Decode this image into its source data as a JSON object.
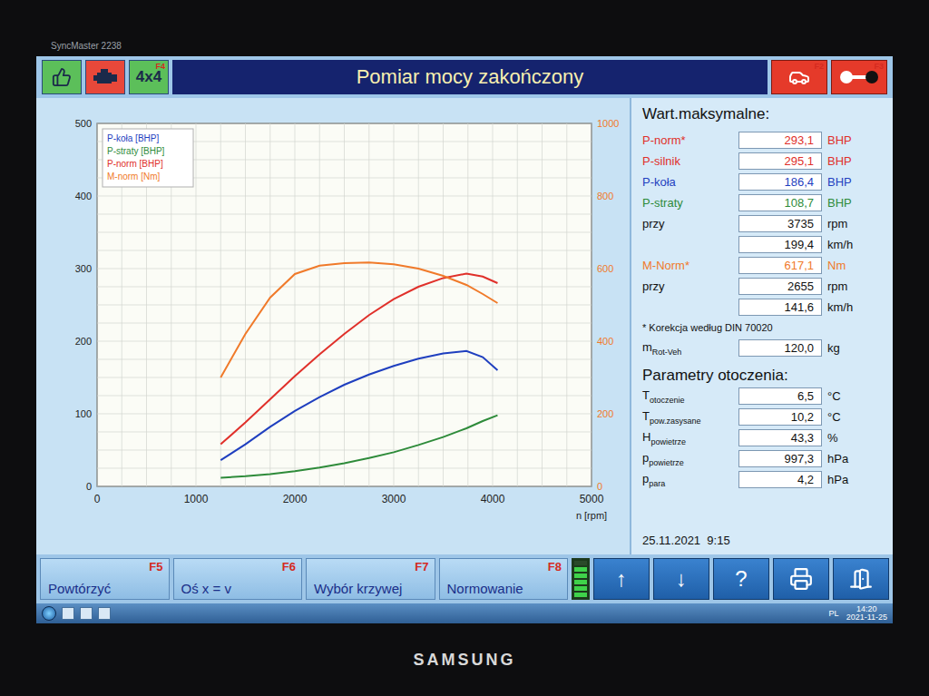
{
  "monitor": {
    "model": "SyncMaster 2238",
    "brand": "SAMSUNG"
  },
  "toolbar": {
    "left": [
      {
        "kind": "thumbs",
        "key": "",
        "color": "#5cbf5a"
      },
      {
        "kind": "engine",
        "key": "",
        "color": "#e8483a"
      },
      {
        "kind": "label",
        "label": "4x4",
        "key": "F4",
        "color": "#5cbf5a"
      }
    ],
    "title": "Pomiar mocy zakończony",
    "right": [
      {
        "kind": "car",
        "key": "F2"
      },
      {
        "kind": "switch",
        "key": "F3"
      }
    ]
  },
  "chart": {
    "y_left_ticks": [
      "0",
      "100",
      "200",
      "300",
      "400",
      "500"
    ],
    "y_right_ticks": [
      "0",
      "200",
      "400",
      "600",
      "800",
      "1000"
    ],
    "x_ticks": [
      "0",
      "1000",
      "2000",
      "3000",
      "4000",
      "5000"
    ],
    "x_label": "n [rpm]",
    "rpm": [
      1250,
      1500,
      1750,
      2000,
      2250,
      2500,
      2750,
      3000,
      3250,
      3500,
      3735,
      3900,
      4050
    ],
    "series": [
      {
        "name": "P-koła [BHP]",
        "axis": "left",
        "color": "#1f3fbf",
        "values": [
          36,
          58,
          82,
          104,
          123,
          140,
          154,
          166,
          176,
          183,
          186.4,
          178,
          160
        ]
      },
      {
        "name": "P-straty [BHP]",
        "axis": "left",
        "color": "#2e8b3a",
        "values": [
          12,
          14,
          17,
          21,
          26,
          32,
          39,
          47,
          57,
          68,
          80,
          90,
          98
        ]
      },
      {
        "name": "P-norm [BHP]",
        "axis": "left",
        "color": "#e0302a",
        "values": [
          58,
          88,
          120,
          152,
          182,
          210,
          236,
          258,
          275,
          287,
          293.1,
          289,
          280
        ]
      },
      {
        "name": "M-norm [Nm]",
        "axis": "right",
        "color": "#f07a2a",
        "values": [
          300,
          420,
          520,
          585,
          608,
          615,
          617.1,
          612,
          600,
          580,
          555,
          530,
          505
        ]
      }
    ]
  },
  "maxima": {
    "title": "Wart.maksymalne:",
    "rows": [
      {
        "label": "P-norm*",
        "sub": "",
        "value": "293,1",
        "unit": "BHP",
        "color": "#e0302a"
      },
      {
        "label": "P-silnik",
        "sub": "",
        "value": "295,1",
        "unit": "BHP",
        "color": "#e0302a"
      },
      {
        "label": "P-koła",
        "sub": "",
        "value": "186,4",
        "unit": "BHP",
        "color": "#1f3fbf"
      },
      {
        "label": "P-straty",
        "sub": "",
        "value": "108,7",
        "unit": "BHP",
        "color": "#2e8b3a"
      },
      {
        "label": "przy",
        "sub": "",
        "value": "3735",
        "unit": "rpm",
        "color": "#111111"
      },
      {
        "label": "",
        "sub": "",
        "value": "199,4",
        "unit": "km/h",
        "color": "#111111"
      },
      {
        "label": "M-Norm*",
        "sub": "",
        "value": "617,1",
        "unit": "Nm",
        "color": "#f07a2a"
      },
      {
        "label": "przy",
        "sub": "",
        "value": "2655",
        "unit": "rpm",
        "color": "#111111"
      },
      {
        "label": "",
        "sub": "",
        "value": "141,6",
        "unit": "km/h",
        "color": "#111111"
      }
    ],
    "note": "* Korekcja według DIN 70020",
    "mass": {
      "label": "m",
      "sub": "Rot-Veh",
      "value": "120,0",
      "unit": "kg",
      "color": "#111111"
    }
  },
  "ambient": {
    "title": "Parametry otoczenia:",
    "rows": [
      {
        "label": "T",
        "sub": "otoczenie",
        "value": "6,5",
        "unit": "°C",
        "color": "#111111"
      },
      {
        "label": "T",
        "sub": "pow.zasysane",
        "value": "10,2",
        "unit": "°C",
        "color": "#111111"
      },
      {
        "label": "H",
        "sub": "powietrze",
        "value": "43,3",
        "unit": "%",
        "color": "#111111"
      },
      {
        "label": "p",
        "sub": "powietrze",
        "value": "997,3",
        "unit": "hPa",
        "color": "#111111"
      },
      {
        "label": "p",
        "sub": "para",
        "value": "4,2",
        "unit": "hPa",
        "color": "#111111"
      }
    ]
  },
  "date": "25.11.2021  9:15",
  "footer": {
    "buttons": [
      {
        "label": "Powtórzyć",
        "key": "F5"
      },
      {
        "label": "Oś x = v",
        "key": "F6"
      },
      {
        "label": "Wybór krzywej",
        "key": "F7"
      },
      {
        "label": "Normowanie",
        "key": "F8"
      }
    ],
    "indicator": {
      "level": 0.85
    },
    "nav": [
      {
        "kind": "text",
        "label": "↑"
      },
      {
        "kind": "text",
        "label": "↓"
      },
      {
        "kind": "text",
        "label": "?"
      },
      {
        "kind": "printer",
        "label": ""
      },
      {
        "kind": "exit",
        "label": ""
      }
    ]
  },
  "taskbar": {
    "language": "PL",
    "time": "14:20",
    "date": "2021-11-25"
  }
}
